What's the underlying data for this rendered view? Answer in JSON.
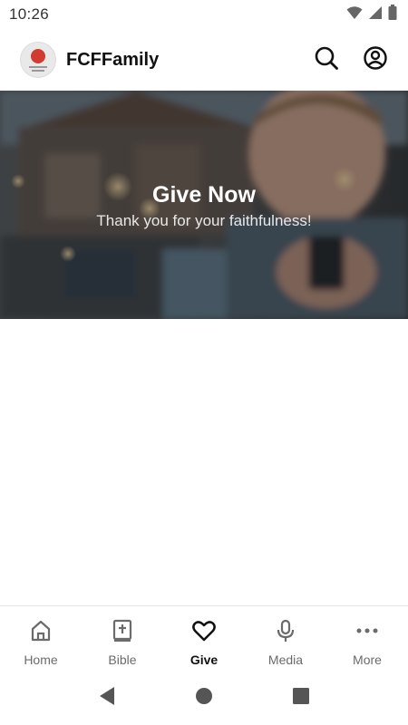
{
  "status_bar": {
    "time": "10:26"
  },
  "app_bar": {
    "title": "FCFFamily"
  },
  "hero": {
    "title": "Give Now",
    "subtitle": "Thank you for your faithfulness!"
  },
  "bottom_nav": {
    "items": [
      {
        "label": "Home",
        "icon": "home-icon",
        "active": false
      },
      {
        "label": "Bible",
        "icon": "bible-icon",
        "active": false
      },
      {
        "label": "Give",
        "icon": "heart-icon",
        "active": true
      },
      {
        "label": "Media",
        "icon": "microphone-icon",
        "active": false
      },
      {
        "label": "More",
        "icon": "more-dots-icon",
        "active": false
      }
    ]
  },
  "colors": {
    "accent_text": "#111111",
    "inactive_text": "#6b6b6b",
    "logo_red": "#d23b2f"
  }
}
